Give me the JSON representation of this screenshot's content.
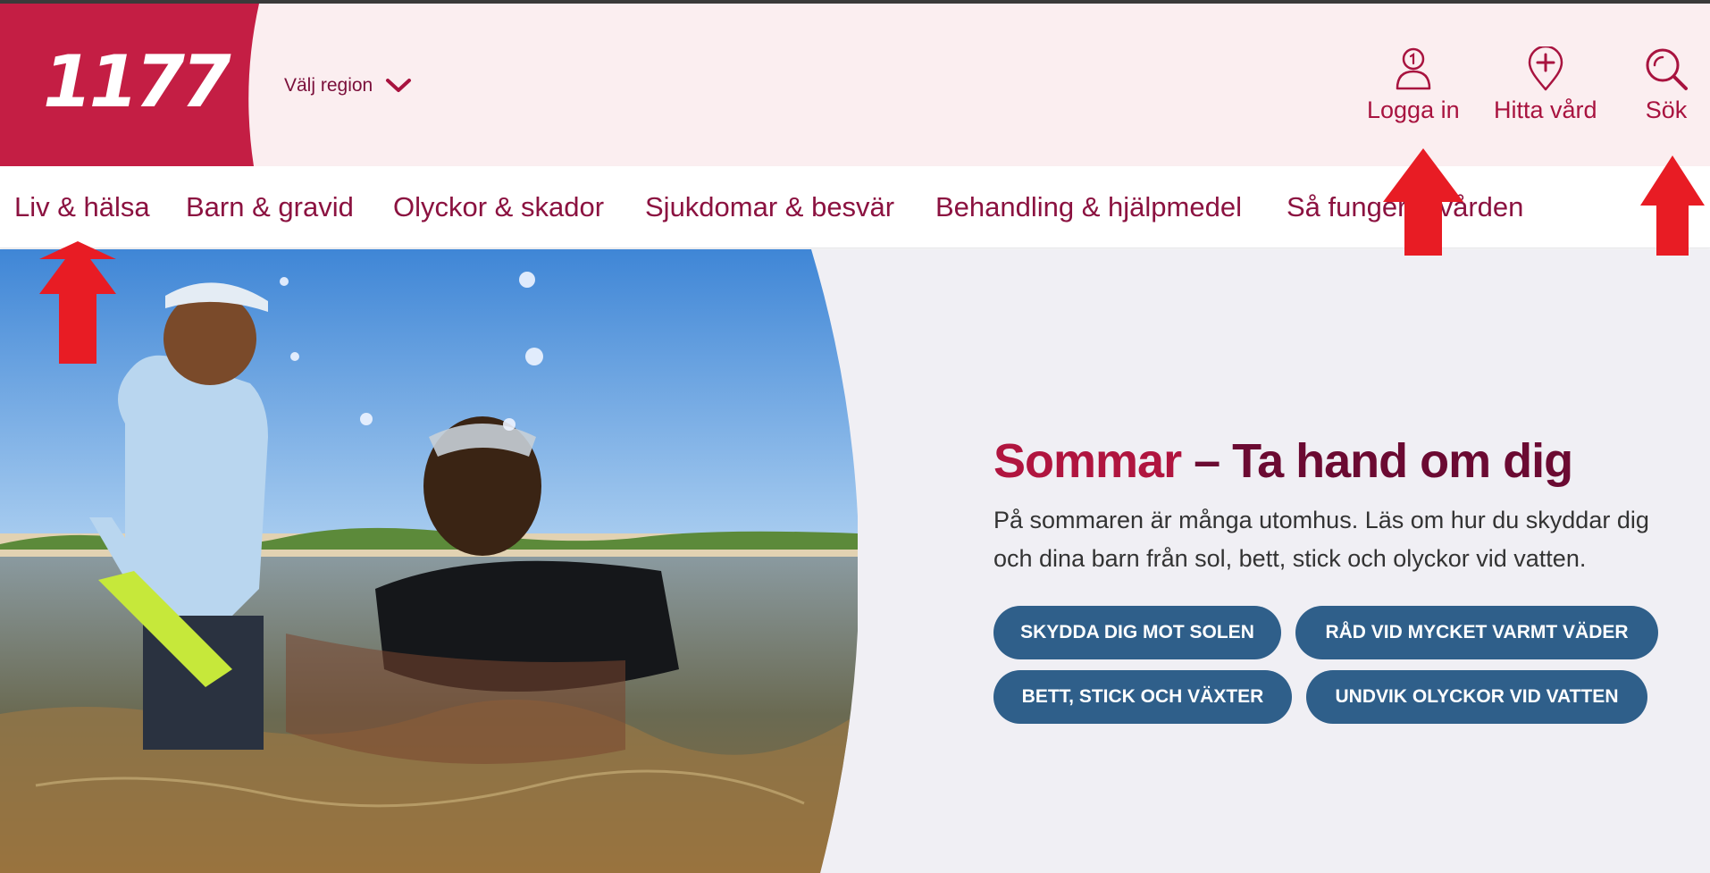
{
  "brand": {
    "logo_text": "1177",
    "color_primary": "#c41e44",
    "color_header_bg": "#fbeef0"
  },
  "header": {
    "region_label": "Välj region",
    "login_label": "Logga in",
    "find_care_label": "Hitta vård",
    "search_label": "Sök"
  },
  "nav": {
    "items": [
      {
        "label": "Liv & hälsa"
      },
      {
        "label": "Barn & gravid"
      },
      {
        "label": "Olyckor & skador"
      },
      {
        "label": "Sjukdomar & besvär"
      },
      {
        "label": "Behandling & hjälpmedel"
      },
      {
        "label": "Så fungerar vården"
      }
    ]
  },
  "hero": {
    "title_accent": "Sommar",
    "title_rest": " – Ta hand om dig",
    "description": "På sommaren är många utomhus. Läs om hur du skyddar dig och dina barn från sol, bett, stick och olyckor vid vatten.",
    "buttons": [
      {
        "label": "SKYDDA DIG MOT SOLEN"
      },
      {
        "label": "RÅD VID MYCKET VARMT VÄDER"
      },
      {
        "label": "BETT, STICK OCH VÄXTER"
      },
      {
        "label": "UNDVIK OLYCKOR VID VATTEN"
      }
    ],
    "button_color": "#2f5f8a"
  },
  "annotations": {
    "arrow_color": "#e81c24",
    "arrows": [
      "nav-liv-halsa",
      "login",
      "search"
    ]
  }
}
